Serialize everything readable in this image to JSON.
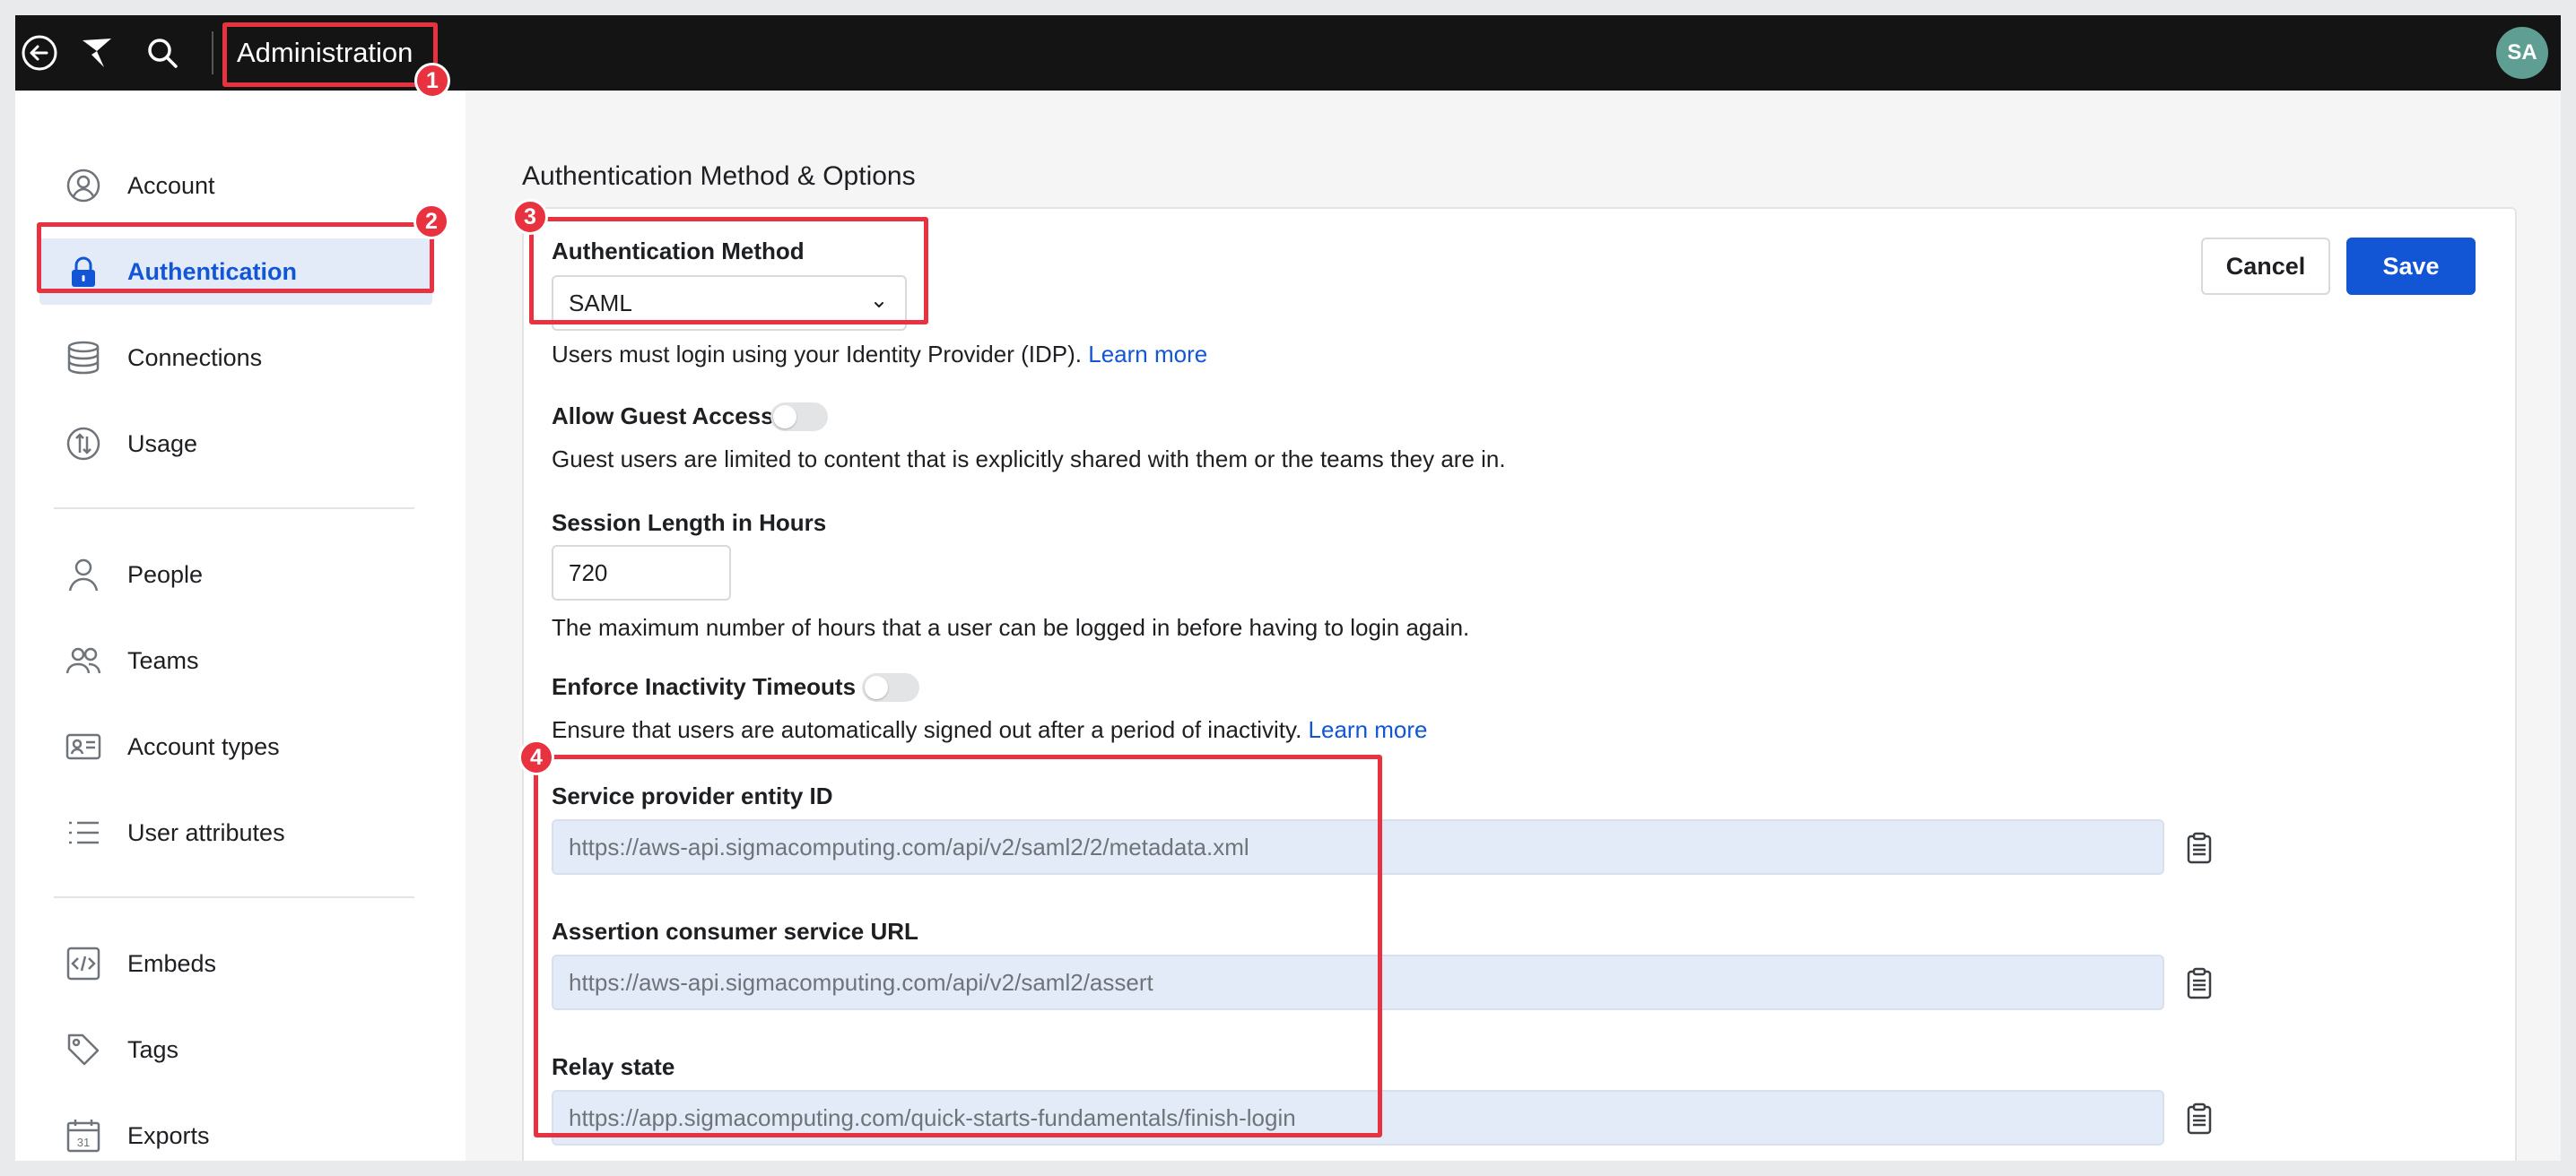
{
  "topbar": {
    "title": "Administration",
    "avatar_initials": "SA",
    "back_icon": "back-arrow-icon",
    "logo_icon": "sigma-logo-icon",
    "search_icon": "search-icon"
  },
  "sidebar": {
    "items": [
      {
        "label": "Account",
        "icon": "user-circle-icon",
        "active": false
      },
      {
        "label": "Authentication",
        "icon": "lock-icon",
        "active": true
      },
      {
        "label": "Connections",
        "icon": "database-icon",
        "active": false
      },
      {
        "label": "Usage",
        "icon": "usage-icon",
        "active": false
      },
      {
        "label": "People",
        "icon": "person-icon",
        "active": false
      },
      {
        "label": "Teams",
        "icon": "team-icon",
        "active": false
      },
      {
        "label": "Account types",
        "icon": "id-card-icon",
        "active": false
      },
      {
        "label": "User attributes",
        "icon": "list-icon",
        "active": false
      },
      {
        "label": "Embeds",
        "icon": "code-icon",
        "active": false
      },
      {
        "label": "Tags",
        "icon": "tag-icon",
        "active": false
      },
      {
        "label": "Exports",
        "icon": "calendar-icon",
        "active": false
      }
    ]
  },
  "main": {
    "title": "Authentication Method & Options",
    "cancel_label": "Cancel",
    "save_label": "Save",
    "auth_method": {
      "label": "Authentication Method",
      "value": "SAML",
      "help": "Users must login using your Identity Provider (IDP).",
      "link": "Learn more"
    },
    "guest_access": {
      "label": "Allow Guest Access",
      "enabled": false,
      "help": "Guest users are limited to content that is explicitly shared with them or the teams they are in."
    },
    "session_length": {
      "label": "Session Length in Hours",
      "value": "720",
      "help": "The maximum number of hours that a user can be logged in before having to login again."
    },
    "inactivity": {
      "label": "Enforce Inactivity Timeouts",
      "enabled": false,
      "help": "Ensure that users are automatically signed out after a period of inactivity.",
      "link": "Learn more"
    },
    "sp_entity_id": {
      "label": "Service provider entity ID",
      "value": "https://aws-api.sigmacomputing.com/api/v2/saml2/2/metadata.xml"
    },
    "acs_url": {
      "label": "Assertion consumer service URL",
      "value": "https://aws-api.sigmacomputing.com/api/v2/saml2/assert"
    },
    "relay_state": {
      "label": "Relay state",
      "value": "https://app.sigmacomputing.com/quick-starts-fundamentals/finish-login"
    }
  },
  "annotations": {
    "badges": [
      "1",
      "2",
      "3",
      "4"
    ],
    "color": "#e8323f"
  },
  "colors": {
    "accent": "#1256d6",
    "topbar": "#141414",
    "active_bg": "#e4ebf8"
  }
}
